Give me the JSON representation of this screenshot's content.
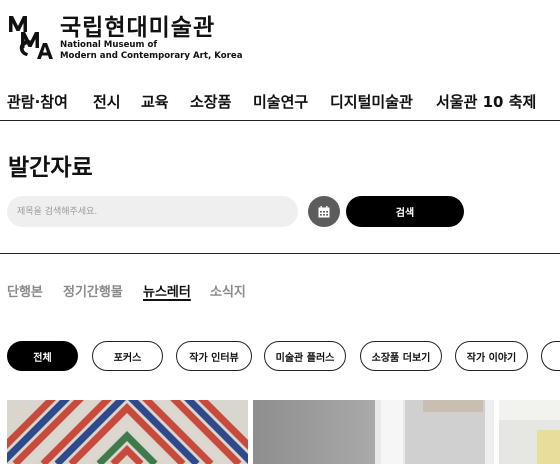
{
  "header": {
    "logo_icon": "mmca-logo",
    "title_ko": "국립현대미술관",
    "title_en_line1": "National Museum of",
    "title_en_line2": "Modern and Contemporary Art, Korea"
  },
  "nav": {
    "items": [
      {
        "label": "관람·참여"
      },
      {
        "label": "전시"
      },
      {
        "label": "교육"
      },
      {
        "label": "소장품"
      },
      {
        "label": "미술연구"
      },
      {
        "label": "디지털미술관"
      },
      {
        "label": "서울관 10 축제"
      }
    ]
  },
  "page": {
    "title": "발간자료"
  },
  "search": {
    "placeholder": "제목을 검색해주세요.",
    "calendar_icon": "calendar-icon",
    "button_label": "검색"
  },
  "tabs": [
    {
      "label": "단행본",
      "active": false
    },
    {
      "label": "정기간행물",
      "active": false
    },
    {
      "label": "뉴스레터",
      "active": true
    },
    {
      "label": "소식지",
      "active": false
    }
  ],
  "filters": [
    {
      "label": "전체",
      "active": true
    },
    {
      "label": "포커스",
      "active": false
    },
    {
      "label": "작가 인터뷰",
      "active": false
    },
    {
      "label": "미술관 플러스",
      "active": false
    },
    {
      "label": "소장품 더보기",
      "active": false
    },
    {
      "label": "작가 이야기",
      "active": false
    },
    {
      "label": "",
      "active": false
    }
  ],
  "colors": {
    "accent": "#000000",
    "chip_border": "#222222",
    "inactive_tab": "#8a8a8a",
    "search_bg": "#efefef",
    "calendar_bg": "#5c5c5c"
  }
}
